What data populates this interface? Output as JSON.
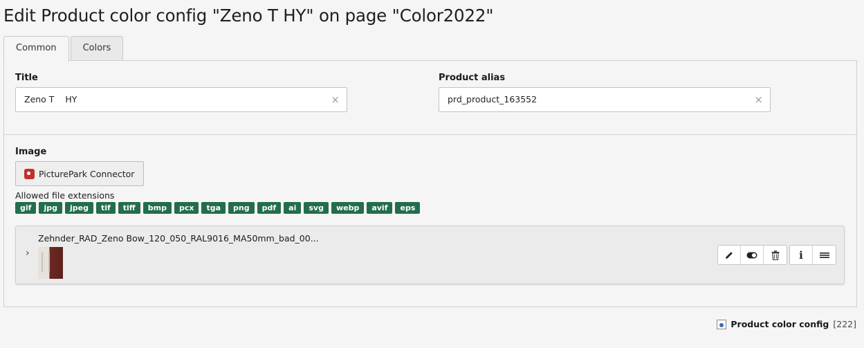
{
  "header": {
    "title": "Edit Product color config \"Zeno T    HY\" on page \"Color2022\""
  },
  "tabs": [
    {
      "label": "Common",
      "active": true
    },
    {
      "label": "Colors",
      "active": false
    }
  ],
  "form": {
    "title": {
      "label": "Title",
      "value": "Zeno T    HY"
    },
    "product_alias": {
      "label": "Product alias",
      "value": "prd_product_163552"
    },
    "image": {
      "label": "Image",
      "connector_button": "PicturePark Connector",
      "allowed_label": "Allowed file extensions",
      "extensions": [
        "gif",
        "jpg",
        "jpeg",
        "tif",
        "tiff",
        "bmp",
        "pcx",
        "tga",
        "png",
        "pdf",
        "ai",
        "svg",
        "webp",
        "avif",
        "eps"
      ],
      "file": {
        "name": "Zehnder_RAD_Zeno Bow_120_050_RAL9016_MA50mm_bad_00...",
        "actions": [
          "edit",
          "toggle",
          "delete",
          "info",
          "menu"
        ]
      }
    }
  },
  "footer": {
    "record_type": "Product color config",
    "record_uid": "[222]"
  },
  "colors": {
    "extension_badge": "#236d4d",
    "icon_red": "#c4302b"
  }
}
